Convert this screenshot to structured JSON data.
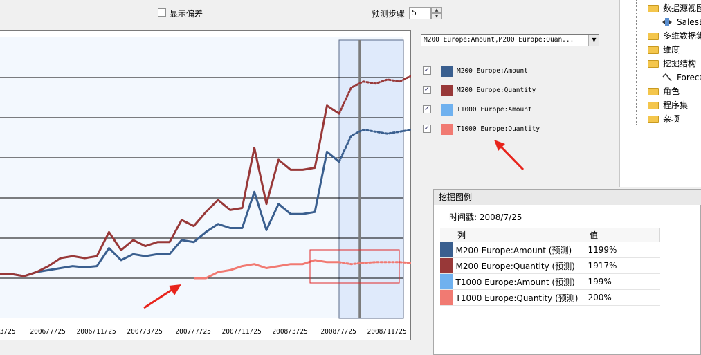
{
  "toolbar": {
    "show_deviation_label": "显示偏差",
    "prediction_steps_label": "预测步骤",
    "prediction_steps_value": "5"
  },
  "legend_panel": {
    "dropdown_value": "M200 Europe:Amount,M200 Europe:Quan...",
    "items": [
      {
        "label": "M200 Europe:Amount",
        "checked": true,
        "color": "#3a5f8f"
      },
      {
        "label": "M200 Europe:Quantity",
        "checked": true,
        "color": "#983838"
      },
      {
        "label": "T1000 Europe:Amount",
        "checked": true,
        "color": "#6fb1ef"
      },
      {
        "label": "T1000 Europe:Quantity",
        "checked": true,
        "color": "#f17a72"
      }
    ]
  },
  "tree": {
    "items": [
      {
        "label": "数据源视图",
        "icon": "folder-icon"
      },
      {
        "label": "SalesE",
        "icon": "data-source-view-icon"
      },
      {
        "label": "多维数据集",
        "icon": "folder-icon"
      },
      {
        "label": "维度",
        "icon": "folder-icon"
      },
      {
        "label": "挖掘结构",
        "icon": "folder-icon"
      },
      {
        "label": "Foreca",
        "icon": "mining-model-icon"
      },
      {
        "label": "角色",
        "icon": "folder-icon"
      },
      {
        "label": "程序集",
        "icon": "folder-icon"
      },
      {
        "label": "杂项",
        "icon": "folder-icon"
      }
    ]
  },
  "mining_legend": {
    "title": "挖掘图例",
    "timestamp": "时间戳: 2008/7/25",
    "col_header": "列",
    "val_header": "值",
    "rows": [
      {
        "name": "M200 Europe:Amount (预测)",
        "value": "1199%",
        "color": "#3a5f8f"
      },
      {
        "name": "M200 Europe:Quantity (预测)",
        "value": "1917%",
        "color": "#983838"
      },
      {
        "name": "T1000 Europe:Amount (预测)",
        "value": "199%",
        "color": "#6fb1ef"
      },
      {
        "name": "T1000 Europe:Quantity (预测)",
        "value": "200%",
        "color": "#f17a72"
      }
    ]
  },
  "chart_data": {
    "type": "line",
    "x": [
      "3/25",
      "",
      "",
      "",
      "2006/7/25",
      "",
      "",
      "",
      "2006/11/25",
      "",
      "",
      "",
      "2007/3/25",
      "",
      "",
      "",
      "2007/7/25",
      "",
      "",
      "",
      "2007/11/25",
      "",
      "",
      "",
      "2008/3/25",
      "",
      "",
      "",
      "2008/7/25",
      "",
      "",
      "",
      "2008/11/25"
    ],
    "xtick_labels": [
      "3/25",
      "2006/7/25",
      "2006/11/25",
      "2007/3/25",
      "2007/7/25",
      "2007/11/25",
      "2008/3/25",
      "2008/7/25",
      "2008/11/25"
    ],
    "ylim": [
      0,
      7
    ],
    "grid": true,
    "series": [
      {
        "name": "M200 Europe:Amount",
        "color": "#3a5f8f",
        "values": [
          1.1,
          1.1,
          1.05,
          1.15,
          1.2,
          1.25,
          1.3,
          1.27,
          1.3,
          1.75,
          1.45,
          1.6,
          1.55,
          1.6,
          1.6,
          1.95,
          1.9,
          2.15,
          2.35,
          2.25,
          2.25,
          3.15,
          2.2,
          2.85,
          2.6,
          2.6,
          2.65,
          4.15,
          3.9
        ],
        "forecast": [
          3.9,
          4.55,
          4.7,
          4.65,
          4.6,
          4.65,
          4.7
        ]
      },
      {
        "name": "M200 Europe:Quantity",
        "color": "#983838",
        "values": [
          1.1,
          1.1,
          1.05,
          1.15,
          1.3,
          1.5,
          1.55,
          1.5,
          1.55,
          2.15,
          1.7,
          1.95,
          1.8,
          1.9,
          1.9,
          2.45,
          2.3,
          2.65,
          2.95,
          2.7,
          2.75,
          4.25,
          2.85,
          3.95,
          3.7,
          3.7,
          3.75,
          5.3,
          5.1
        ],
        "forecast": [
          5.1,
          5.75,
          5.9,
          5.85,
          5.95,
          5.9,
          6.05
        ]
      },
      {
        "name": "T1000 Europe:Amount",
        "color": "#6fb1ef",
        "values": [],
        "forecast": []
      },
      {
        "name": "T1000 Europe:Quantity",
        "color": "#f17a72",
        "values": [
          null,
          null,
          null,
          null,
          null,
          null,
          null,
          null,
          null,
          null,
          null,
          null,
          null,
          null,
          null,
          null,
          1.0,
          1.0,
          1.15,
          1.2,
          1.3,
          1.35,
          1.25,
          1.3,
          1.35,
          1.35,
          1.45,
          1.4,
          1.4
        ],
        "forecast": [
          1.4,
          1.35,
          1.38,
          1.4,
          1.4,
          1.4,
          1.38
        ]
      }
    ]
  }
}
